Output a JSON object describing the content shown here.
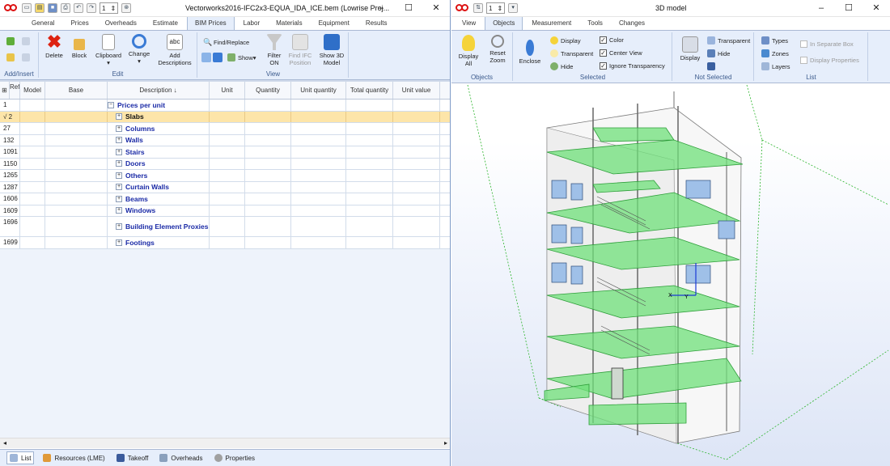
{
  "left": {
    "title": "Vectorworks2016-IFC2x3-EQUA_IDA_ICE.bem (Lowrise Proj...",
    "page_spinner": "1",
    "tabs": [
      "General",
      "Prices",
      "Overheads",
      "Estimate",
      "BIM Prices",
      "Labor",
      "Materials",
      "Equipment",
      "Results"
    ],
    "active_tab": "BIM Prices",
    "groups": {
      "add_insert": "Add/Insert",
      "edit": "Edit",
      "view": "View"
    },
    "buttons": {
      "delete": "Delete",
      "block": "Block",
      "clipboard": "Clipboard",
      "change": "Change",
      "add_descriptions": "Add Descriptions",
      "find_replace": "Find/Replace",
      "show": "Show",
      "filter_on": "Filter ON",
      "find_ifc": "Find IFC Position",
      "show_3d": "Show 3D Model"
    },
    "columns": [
      "Ref. f.",
      "Model",
      "Base",
      "Description ↓",
      "Unit",
      "Quantity",
      "Unit quantity",
      "Total quantity",
      "Unit value"
    ],
    "rows": [
      {
        "ref": "1",
        "label": "Prices per unit",
        "expander": "−"
      },
      {
        "ref": "√ 2",
        "label": "Slabs",
        "expander": "+"
      },
      {
        "ref": "27",
        "label": "Columns",
        "expander": "+"
      },
      {
        "ref": "132",
        "label": "Walls",
        "expander": "+"
      },
      {
        "ref": "1091",
        "label": "Stairs",
        "expander": "+"
      },
      {
        "ref": "1150",
        "label": "Doors",
        "expander": "+"
      },
      {
        "ref": "1265",
        "label": "Others",
        "expander": "+"
      },
      {
        "ref": "1287",
        "label": "Curtain Walls",
        "expander": "+"
      },
      {
        "ref": "1606",
        "label": "Beams",
        "expander": "+"
      },
      {
        "ref": "1609",
        "label": "Windows",
        "expander": "+"
      },
      {
        "ref": "1696",
        "label": "Building Element Proxies",
        "expander": "+"
      },
      {
        "ref": "1699",
        "label": "Footings",
        "expander": "+"
      }
    ],
    "bottom_tabs": [
      "List",
      "Resources (LME)",
      "Takeoff",
      "Overheads",
      "Properties"
    ]
  },
  "right": {
    "title": "3D model",
    "page_spinner": "1",
    "tabs": [
      "View",
      "Objects",
      "Measurement",
      "Tools",
      "Changes"
    ],
    "active_tab": "Objects",
    "groups": {
      "objects": "Objects",
      "selected": "Selected",
      "not_selected": "Not Selected",
      "list": "List"
    },
    "buttons": {
      "display_all": "Display All",
      "reset_zoom": "Reset Zoom",
      "enclose": "Enclose",
      "display": "Display",
      "transparent": "Transparent",
      "hide": "Hide",
      "color": "Color",
      "center_view": "Center View",
      "ignore_transparency": "Ignore Transparency",
      "ns_display": "Display",
      "ns_transparent": "Transparent",
      "ns_hide": "Hide",
      "types": "Types",
      "zones": "Zones",
      "layers": "Layers",
      "in_separate_box": "In Separate Box",
      "display_properties": "Display Properties"
    },
    "axis_labels": {
      "x": "X",
      "y": "Y"
    }
  },
  "colors": {
    "ribbon_bg": "#e6eefb",
    "accent_blue": "#1a2aa6",
    "selected_row": "#fde5a9",
    "green_slab": "#6fe07a"
  }
}
